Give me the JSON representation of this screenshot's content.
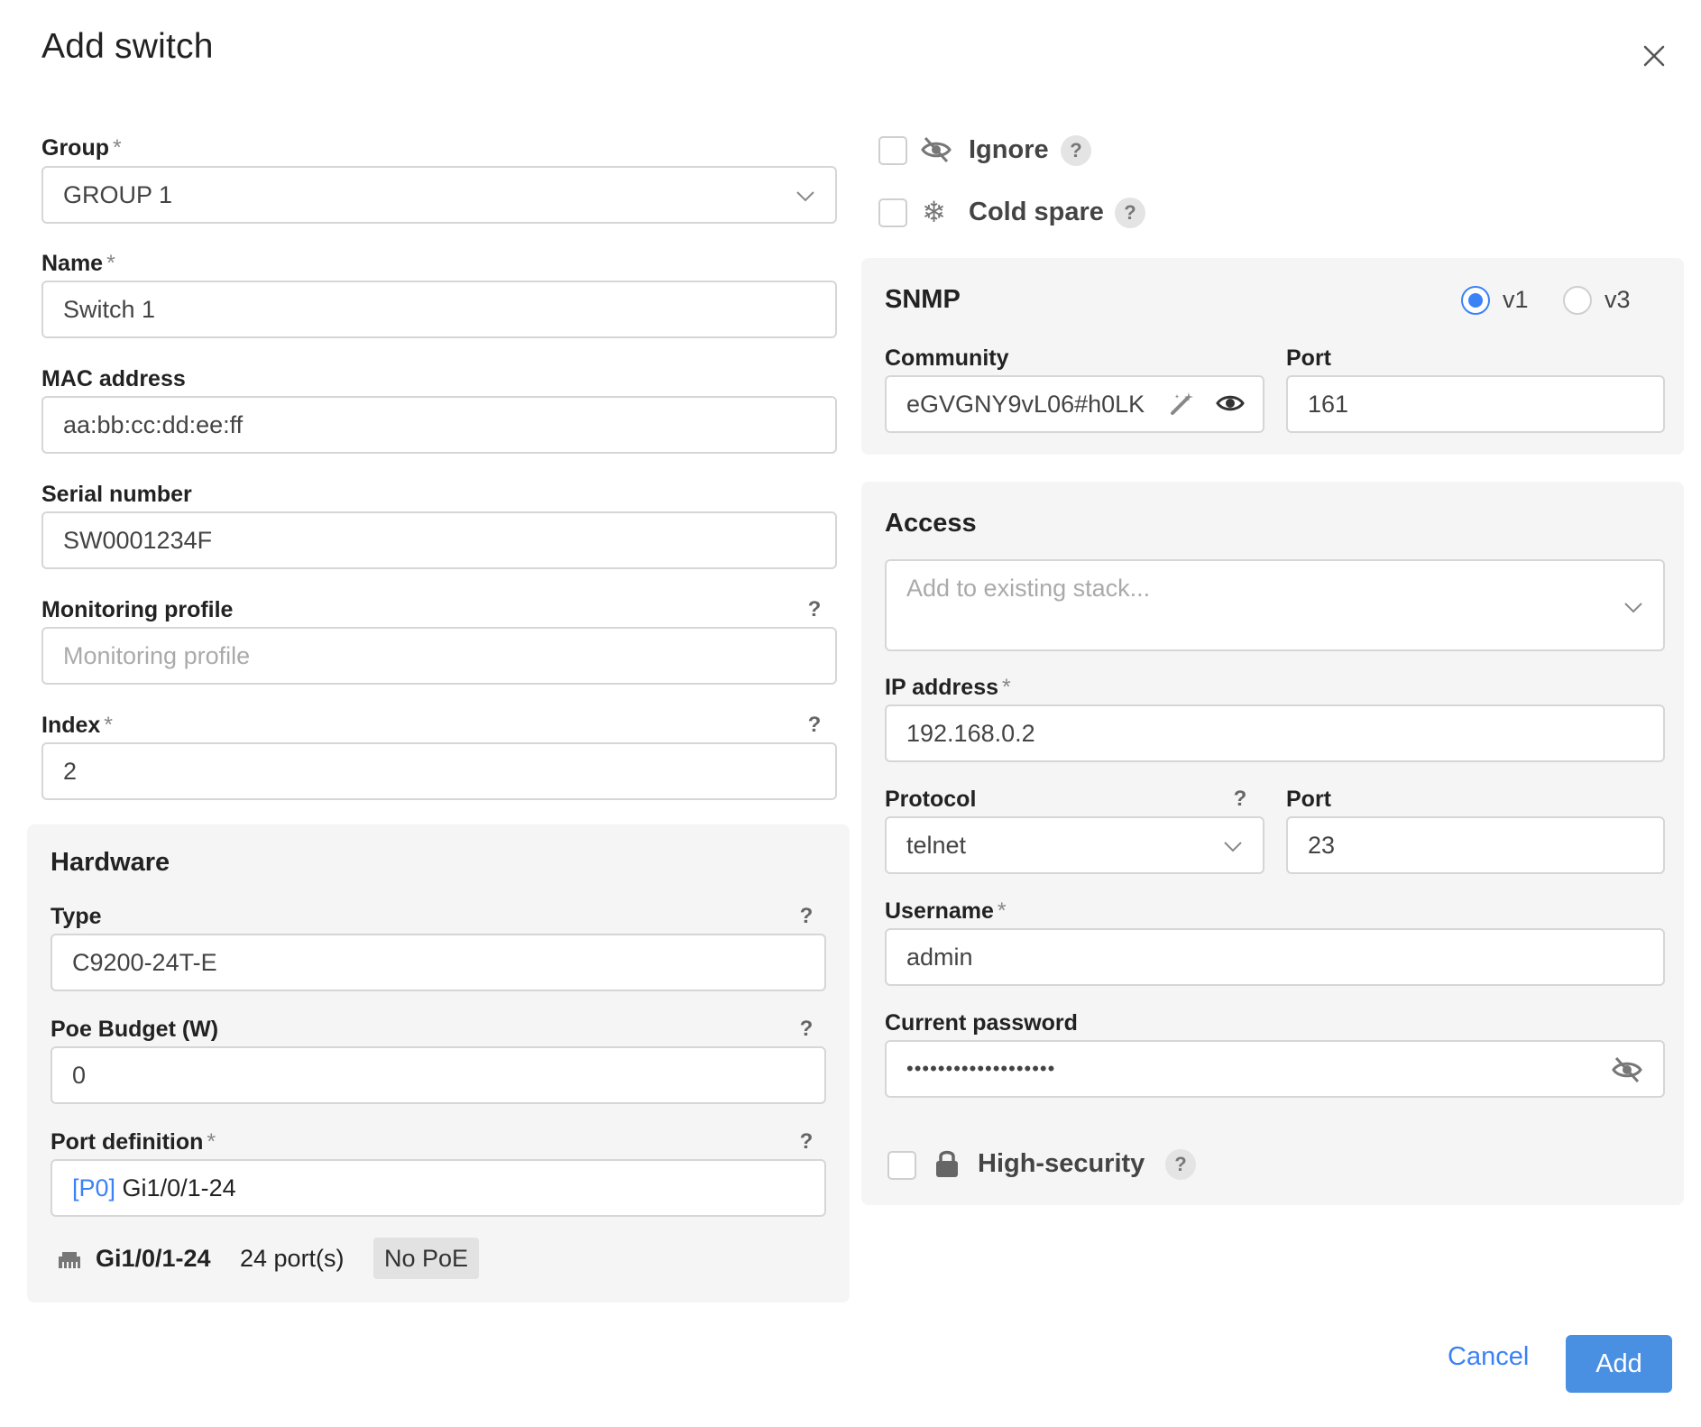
{
  "dialog": {
    "title": "Add switch"
  },
  "left": {
    "group": {
      "label": "Group",
      "value": "GROUP 1"
    },
    "name": {
      "label": "Name",
      "value": "Switch 1"
    },
    "mac": {
      "label": "MAC address",
      "value": "aa:bb:cc:dd:ee:ff"
    },
    "serial": {
      "label": "Serial number",
      "value": "SW0001234F"
    },
    "monitoring": {
      "label": "Monitoring profile",
      "placeholder": "Monitoring profile"
    },
    "index": {
      "label": "Index",
      "value": "2"
    }
  },
  "hardware": {
    "title": "Hardware",
    "type": {
      "label": "Type",
      "value": "C9200-24T-E"
    },
    "poe": {
      "label": "Poe Budget (W)",
      "value": "0"
    },
    "portdef": {
      "label": "Port definition",
      "tag": "[P0]",
      "value": "Gi1/0/1-24"
    },
    "summary": {
      "range": "Gi1/0/1-24",
      "count": "24 port(s)",
      "badge": "No PoE"
    }
  },
  "options": {
    "ignore": {
      "label": "Ignore",
      "icon": "eye-slash-icon"
    },
    "cold_spare": {
      "label": "Cold spare",
      "icon": "snowflake-icon"
    }
  },
  "snmp": {
    "title": "SNMP",
    "v1": "v1",
    "v3": "v3",
    "community": {
      "label": "Community",
      "value": "eGVGNY9vL06#h0LK"
    },
    "port": {
      "label": "Port",
      "value": "161"
    }
  },
  "access": {
    "title": "Access",
    "stack": {
      "placeholder": "Add to existing stack..."
    },
    "ip": {
      "label": "IP address",
      "value": "192.168.0.2"
    },
    "protocol": {
      "label": "Protocol",
      "value": "telnet"
    },
    "port": {
      "label": "Port",
      "value": "23"
    },
    "username": {
      "label": "Username",
      "value": "admin"
    },
    "password": {
      "label": "Current password",
      "value": "•••••••••••••••••••"
    },
    "high_security": {
      "label": "High-security"
    }
  },
  "help": "?",
  "required_mark": "*",
  "footer": {
    "cancel": "Cancel",
    "add": "Add"
  },
  "colors": {
    "accent": "#3b82f6",
    "panel": "#f5f5f5",
    "border": "#d6d6d6"
  }
}
